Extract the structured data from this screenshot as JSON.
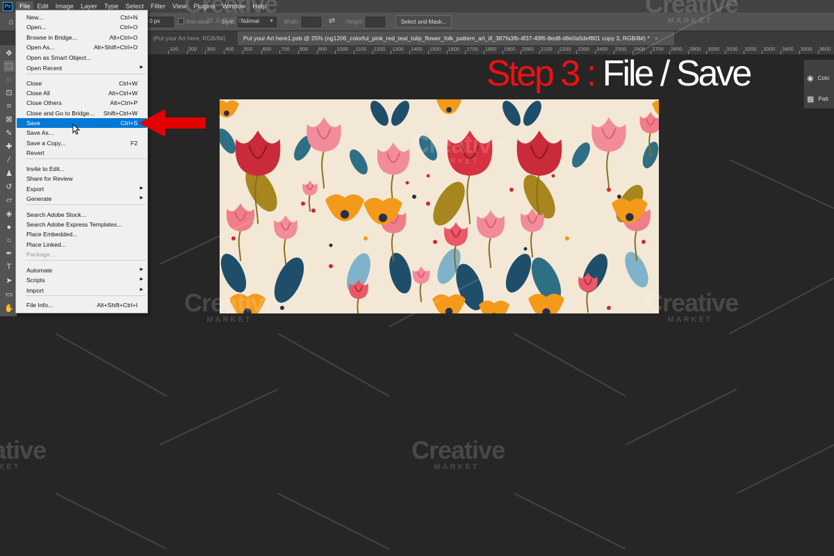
{
  "app": {
    "logo": "Ps"
  },
  "menubar": {
    "items": [
      "File",
      "Edit",
      "Image",
      "Layer",
      "Type",
      "Select",
      "Filter",
      "View",
      "Plugins",
      "Window",
      "Help"
    ]
  },
  "options": {
    "feather_value": "0 px",
    "anti_alias_label": "Anti-alias",
    "style_label": "Style:",
    "style_value": "Normal",
    "width_label": "Width:",
    "height_label": "Height:",
    "select_mask_label": "Select and Mask..."
  },
  "tabs": [
    {
      "label": "(Put your Art here, RGB/8#)"
    },
    {
      "label": "Put your Art here1.psb @ 25% (ng1206_colorful_pink_red_teal_tulip_flower_folk_pattern_art_ill_387fa3fb-4f37-49f6-8ed8-d8e0a5def801 copy 3, RGB/8#) *"
    }
  ],
  "ruler": {
    "labels": [
      "100",
      "200",
      "300",
      "400",
      "500",
      "600",
      "700",
      "800",
      "900",
      "1000",
      "1100",
      "1200",
      "1300",
      "1400",
      "1500",
      "1600",
      "1700",
      "1800",
      "1900",
      "2000",
      "2100",
      "2200",
      "2300",
      "2400",
      "2500",
      "2600",
      "2700",
      "2800",
      "2900",
      "3000",
      "3100",
      "3200",
      "3300",
      "3400",
      "3500",
      "3600"
    ]
  },
  "file_menu": {
    "items": [
      {
        "label": "New...",
        "shortcut": "Ctrl+N"
      },
      {
        "label": "Open...",
        "shortcut": "Ctrl+O"
      },
      {
        "label": "Browse in Bridge...",
        "shortcut": "Alt+Ctrl+O"
      },
      {
        "label": "Open As...",
        "shortcut": "Alt+Shift+Ctrl+O"
      },
      {
        "label": "Open as Smart Object...",
        "shortcut": ""
      },
      {
        "label": "Open Recent",
        "shortcut": "",
        "submenu": true
      },
      {
        "label": "Close",
        "shortcut": "Ctrl+W"
      },
      {
        "label": "Close All",
        "shortcut": "Alt+Ctrl+W"
      },
      {
        "label": "Close Others",
        "shortcut": "Alt+Ctrl+P"
      },
      {
        "label": "Close and Go to Bridge...",
        "shortcut": "Shift+Ctrl+W"
      },
      {
        "label": "Save",
        "shortcut": "Ctrl+S",
        "highlighted": true
      },
      {
        "label": "Save As...",
        "shortcut": ""
      },
      {
        "label": "Save a Copy...",
        "shortcut": "F2"
      },
      {
        "label": "Revert",
        "shortcut": ""
      },
      {
        "label": "Invite to Edit...",
        "shortcut": ""
      },
      {
        "label": "Share for Review",
        "shortcut": ""
      },
      {
        "label": "Export",
        "shortcut": "",
        "submenu": true
      },
      {
        "label": "Generate",
        "shortcut": "",
        "submenu": true
      },
      {
        "label": "Search Adobe Stock...",
        "shortcut": ""
      },
      {
        "label": "Search Adobe Express Templates...",
        "shortcut": ""
      },
      {
        "label": "Place Embedded...",
        "shortcut": ""
      },
      {
        "label": "Place Linked...",
        "shortcut": ""
      },
      {
        "label": "Package...",
        "shortcut": "",
        "disabled": true
      },
      {
        "label": "Automate",
        "shortcut": "",
        "submenu": true
      },
      {
        "label": "Scripts",
        "shortcut": "",
        "submenu": true
      },
      {
        "label": "Import",
        "shortcut": "",
        "submenu": true
      },
      {
        "label": "File Info...",
        "shortcut": "Alt+Shift+Ctrl+I"
      }
    ],
    "submenu_arrow": "▶"
  },
  "overlay": {
    "step_prefix": "Step 3 :",
    "step_action": "File / Save"
  },
  "right_panel": {
    "items": [
      "Colo",
      "Patt"
    ]
  },
  "watermark": {
    "brand": "Creative",
    "sub": "MARKET"
  },
  "colors": {
    "highlight": "#0078d7",
    "arrow": "#e50000",
    "step_red": "#ee1111",
    "canvas_bg": "#262626"
  }
}
